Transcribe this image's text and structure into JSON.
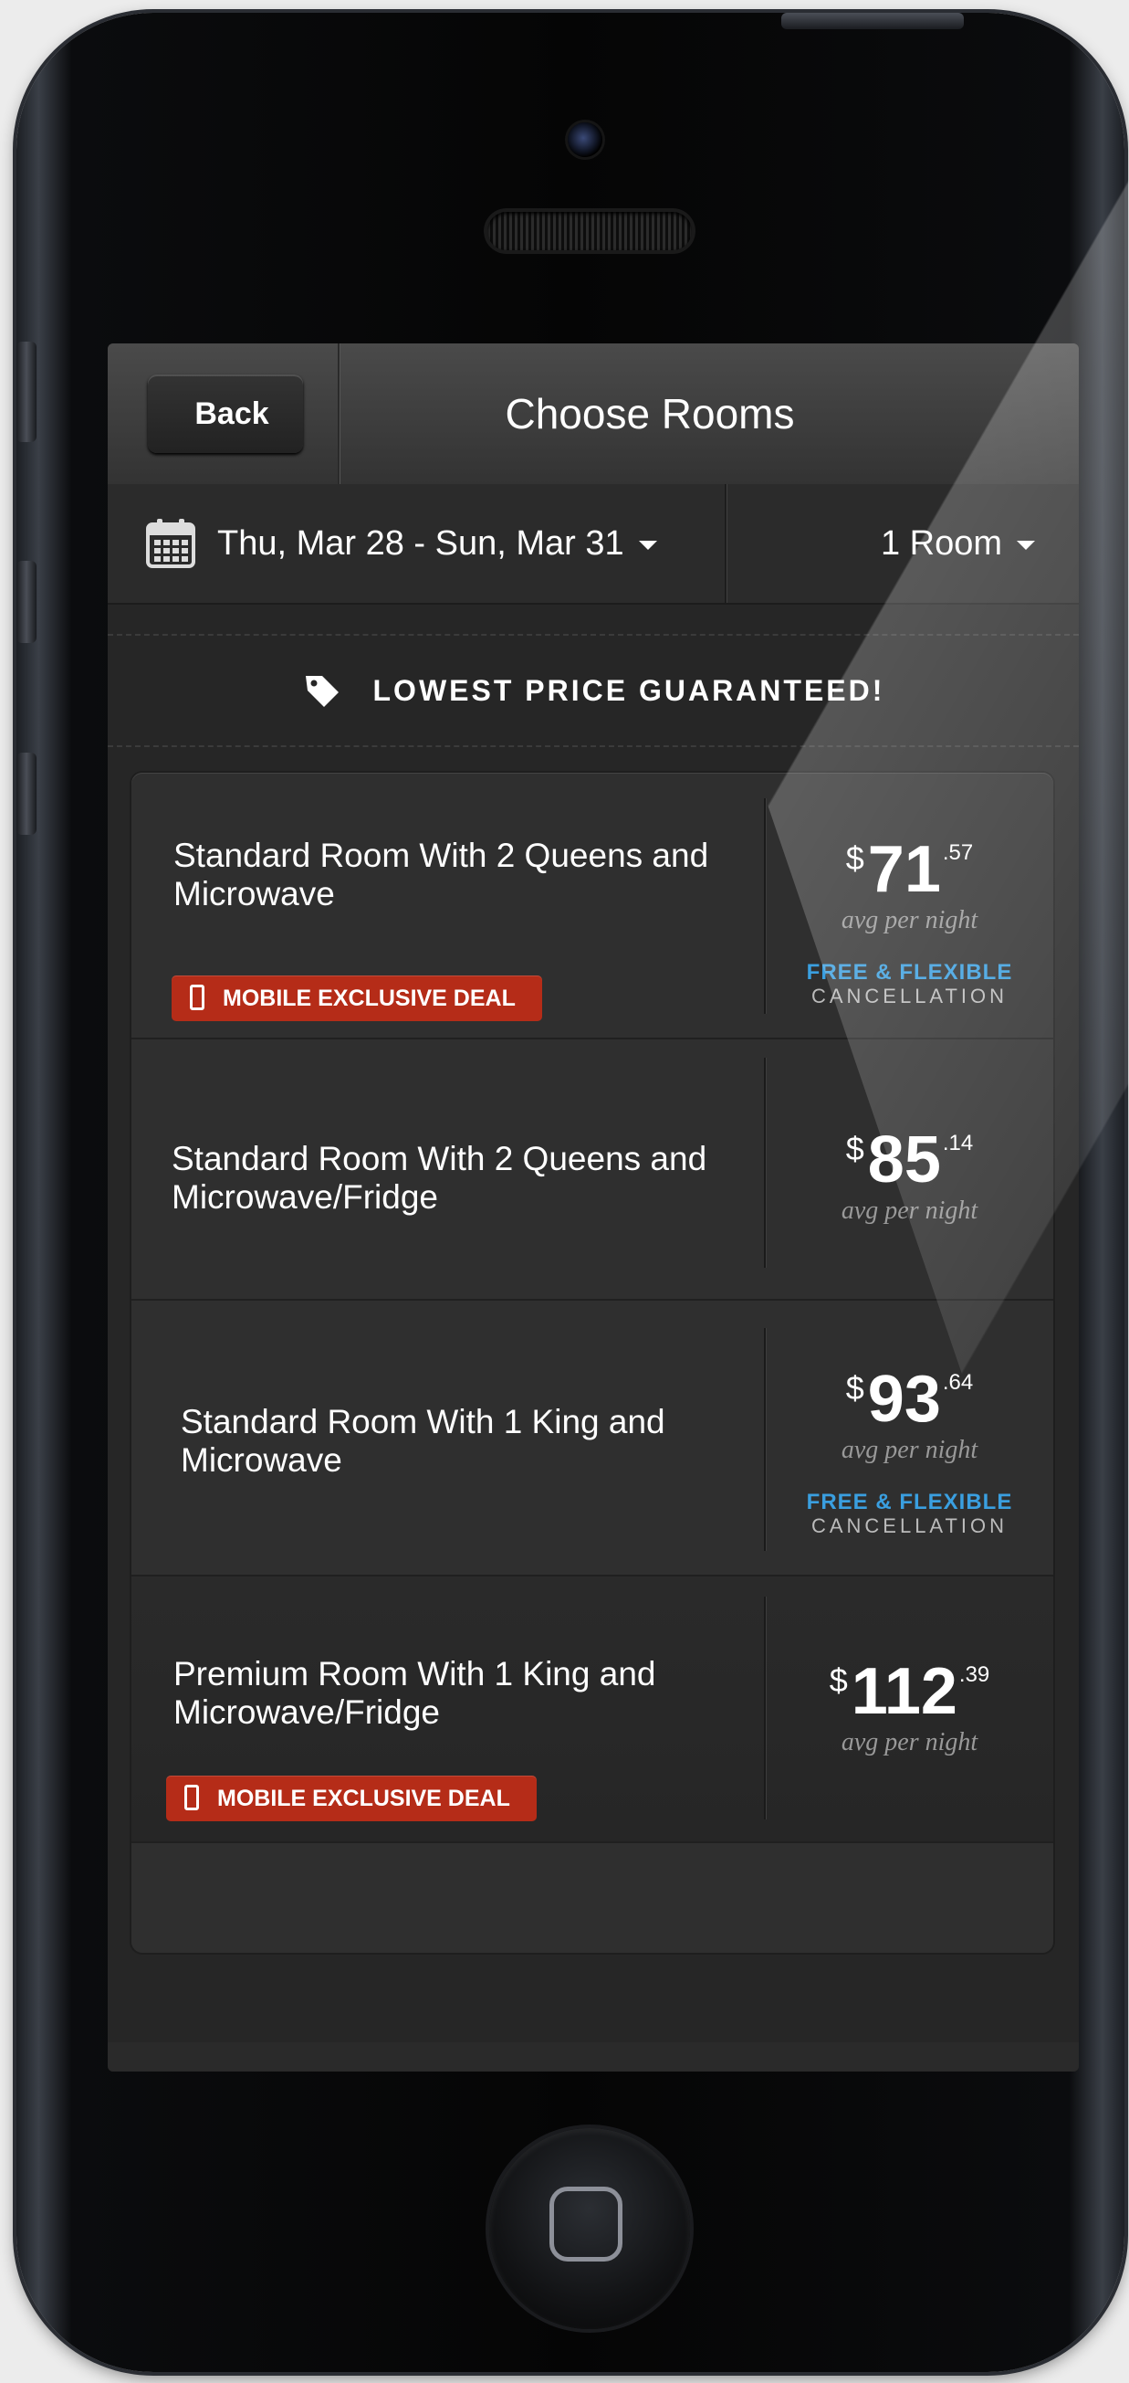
{
  "navbar": {
    "back_label": "Back",
    "title": "Choose Rooms"
  },
  "filters": {
    "dates": "Thu, Mar 28 - Sun, Mar 31",
    "rooms": "1 Room"
  },
  "banner": {
    "text": "LOWEST PRICE GUARANTEED!"
  },
  "rooms": [
    {
      "name": "Standard Room With 2 Queens and Microwave",
      "currency": "$",
      "price_whole": "71",
      "price_cents": ".57",
      "avg_label": "avg per night",
      "free_label": "FREE & FLEXIBLE",
      "cancel_label": "CANCELLATION",
      "deal_label": "MOBILE EXCLUSIVE DEAL"
    },
    {
      "name": "Standard Room With 2 Queens and Microwave/Fridge",
      "currency": "$",
      "price_whole": "85",
      "price_cents": ".14",
      "avg_label": "avg per night"
    },
    {
      "name": "Standard Room With 1 King and Microwave",
      "currency": "$",
      "price_whole": "93",
      "price_cents": ".64",
      "avg_label": "avg per night",
      "free_label": "FREE & FLEXIBLE",
      "cancel_label": "CANCELLATION"
    },
    {
      "name": "Premium Room With 1 King and Microwave/Fridge",
      "currency": "$",
      "price_whole": "112",
      "price_cents": ".39",
      "avg_label": "avg per night",
      "deal_label": "MOBILE EXCLUSIVE DEAL"
    }
  ],
  "colors": {
    "deal_red": "#b52c18",
    "free_blue": "#3a9fe0",
    "background": "#262626"
  },
  "icons": {
    "calendar": "calendar-icon",
    "tag": "price-tag-icon",
    "mobile": "mobile-phone-icon",
    "caret": "caret-down-icon"
  }
}
